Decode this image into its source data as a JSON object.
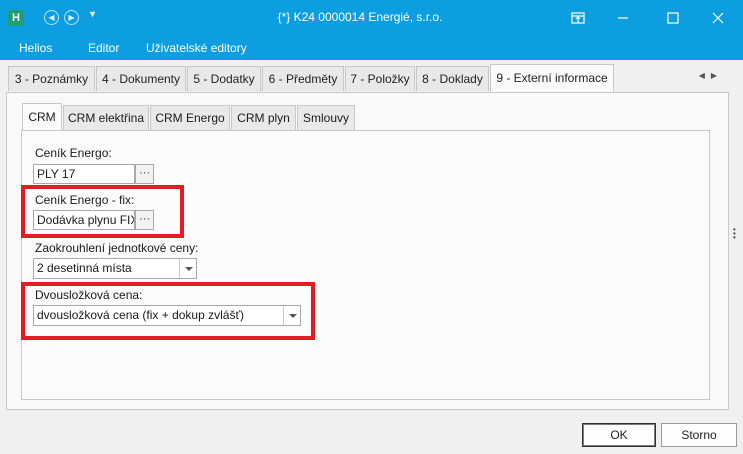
{
  "titlebar": {
    "app_icon_letter": "H",
    "title": "{*} K24 0000014  Energié, s.r.o."
  },
  "menu": {
    "items": [
      "Helios",
      "Editor",
      "Uživatelské editory"
    ]
  },
  "outer_tabs": [
    {
      "label": "3 - Poznámky",
      "active": false
    },
    {
      "label": "4 - Dokumenty",
      "active": false
    },
    {
      "label": "5 - Dodatky",
      "active": false
    },
    {
      "label": "6 - Předměty",
      "active": false
    },
    {
      "label": "7 - Položky",
      "active": false
    },
    {
      "label": "8 - Doklady",
      "active": false
    },
    {
      "label": "9 - Externí informace",
      "active": true
    }
  ],
  "inner_tabs": [
    {
      "label": "CRM",
      "active": true
    },
    {
      "label": "CRM elektřina",
      "active": false
    },
    {
      "label": "CRM Energo",
      "active": false
    },
    {
      "label": "CRM plyn",
      "active": false
    },
    {
      "label": "Smlouvy",
      "active": false
    }
  ],
  "form": {
    "cenik_label": "Ceník Energo:",
    "cenik_value": "PLY 17",
    "cenik_fix_label": "Ceník Energo - fix:",
    "cenik_fix_value": "Dodávka plynu FIX",
    "zaokrouhleni_label": "Zaokrouhlení jednotkové ceny:",
    "zaokrouhleni_value": "2 desetinná místa",
    "dvouslozkova_label": "Dvousložková cena:",
    "dvouslozkova_value": "dvousložková cena (fix + dokup zvlášť)",
    "ellipsis": "···"
  },
  "buttons": {
    "ok": "OK",
    "cancel": "Storno"
  },
  "colors": {
    "titlebar": "#0c9ee0",
    "highlight": "#e31b23"
  }
}
